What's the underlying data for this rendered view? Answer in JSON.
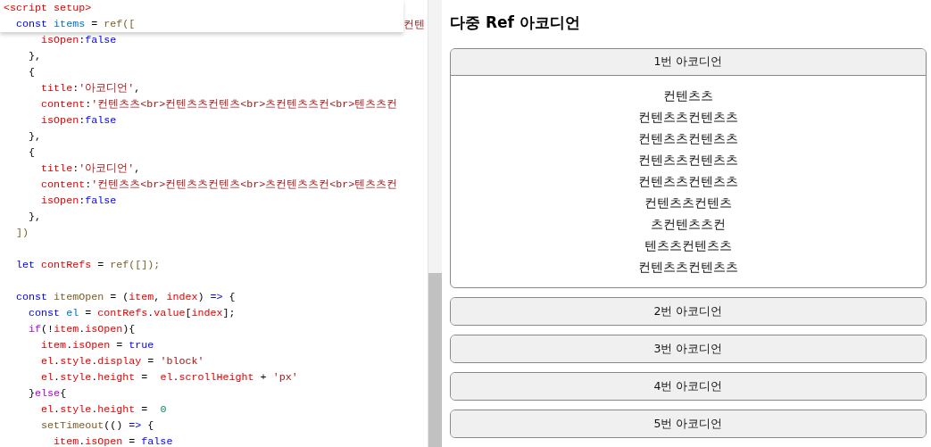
{
  "editor": {
    "sticky_lines": [
      {
        "kind": "code",
        "tokens": [
          {
            "text": "<script setup>",
            "kind": "tag"
          }
        ]
      },
      {
        "kind": "code",
        "tokens": [
          {
            "text": "  const ",
            "kind": "kw"
          },
          {
            "text": "items",
            "kind": "var"
          },
          {
            "text": " = ",
            "kind": "punc"
          },
          {
            "text": "ref",
            "kind": "fn"
          },
          {
            "text": "([",
            "kind": "bracket"
          }
        ]
      }
    ],
    "peek_text": "컨텐",
    "lines": [
      {
        "kind": "code",
        "tokens": [
          {
            "text": "      isOpen",
            "kind": "prop"
          },
          {
            "text": ":",
            "kind": "punc"
          },
          {
            "text": "false",
            "kind": "kw"
          }
        ]
      },
      {
        "kind": "code",
        "tokens": [
          {
            "text": "    },",
            "kind": "punc"
          }
        ]
      },
      {
        "kind": "code",
        "tokens": [
          {
            "text": "    {",
            "kind": "punc"
          }
        ]
      },
      {
        "kind": "code",
        "tokens": [
          {
            "text": "      title",
            "kind": "prop"
          },
          {
            "text": ":",
            "kind": "punc"
          },
          {
            "text": "'아코디언'",
            "kind": "str"
          },
          {
            "text": ",",
            "kind": "punc"
          }
        ]
      },
      {
        "kind": "code",
        "tokens": [
          {
            "text": "      content",
            "kind": "prop"
          },
          {
            "text": ":",
            "kind": "punc"
          },
          {
            "text": "'컨텐츠츠<br>컨텐츠츠컨텐츠<br>츠컨텐츠츠컨<br>텐츠츠컨",
            "kind": "str"
          }
        ]
      },
      {
        "kind": "code",
        "tokens": [
          {
            "text": "      isOpen",
            "kind": "prop"
          },
          {
            "text": ":",
            "kind": "punc"
          },
          {
            "text": "false",
            "kind": "kw"
          }
        ]
      },
      {
        "kind": "code",
        "tokens": [
          {
            "text": "    },",
            "kind": "punc"
          }
        ]
      },
      {
        "kind": "code",
        "tokens": [
          {
            "text": "    {",
            "kind": "punc"
          }
        ]
      },
      {
        "kind": "code",
        "tokens": [
          {
            "text": "      title",
            "kind": "prop"
          },
          {
            "text": ":",
            "kind": "punc"
          },
          {
            "text": "'아코디언'",
            "kind": "str"
          },
          {
            "text": ",",
            "kind": "punc"
          }
        ]
      },
      {
        "kind": "code",
        "tokens": [
          {
            "text": "      content",
            "kind": "prop"
          },
          {
            "text": ":",
            "kind": "punc"
          },
          {
            "text": "'컨텐츠츠<br>컨텐츠츠컨텐츠<br>츠컨텐츠츠컨<br>텐츠츠컨",
            "kind": "str"
          }
        ]
      },
      {
        "kind": "code",
        "tokens": [
          {
            "text": "      isOpen",
            "kind": "prop"
          },
          {
            "text": ":",
            "kind": "punc"
          },
          {
            "text": "false",
            "kind": "kw"
          }
        ]
      },
      {
        "kind": "code",
        "tokens": [
          {
            "text": "    },",
            "kind": "punc"
          }
        ]
      },
      {
        "kind": "code",
        "tokens": [
          {
            "text": "  ])",
            "kind": "bracket"
          }
        ]
      },
      {
        "kind": "blank"
      },
      {
        "kind": "code",
        "tokens": [
          {
            "text": "  let ",
            "kind": "kw"
          },
          {
            "text": "contRefs",
            "kind": "prop"
          },
          {
            "text": " = ",
            "kind": "punc"
          },
          {
            "text": "ref",
            "kind": "fn"
          },
          {
            "text": "([]);",
            "kind": "bracket"
          }
        ]
      },
      {
        "kind": "blank"
      },
      {
        "kind": "code",
        "tokens": [
          {
            "text": "  const ",
            "kind": "kw"
          },
          {
            "text": "itemOpen",
            "kind": "fn"
          },
          {
            "text": " = (",
            "kind": "punc"
          },
          {
            "text": "item",
            "kind": "prop"
          },
          {
            "text": ", ",
            "kind": "punc"
          },
          {
            "text": "index",
            "kind": "prop"
          },
          {
            "text": ") ",
            "kind": "punc"
          },
          {
            "text": "=>",
            "kind": "kw"
          },
          {
            "text": " {",
            "kind": "punc"
          }
        ]
      },
      {
        "kind": "code",
        "tokens": [
          {
            "text": "    const ",
            "kind": "kw"
          },
          {
            "text": "el",
            "kind": "var"
          },
          {
            "text": " = ",
            "kind": "punc"
          },
          {
            "text": "contRefs",
            "kind": "prop"
          },
          {
            "text": ".",
            "kind": "punc"
          },
          {
            "text": "value",
            "kind": "prop"
          },
          {
            "text": "[",
            "kind": "punc"
          },
          {
            "text": "index",
            "kind": "prop"
          },
          {
            "text": "];",
            "kind": "punc"
          }
        ]
      },
      {
        "kind": "code",
        "tokens": [
          {
            "text": "    if",
            "kind": "ctrl"
          },
          {
            "text": "(!",
            "kind": "punc"
          },
          {
            "text": "item",
            "kind": "prop"
          },
          {
            "text": ".",
            "kind": "punc"
          },
          {
            "text": "isOpen",
            "kind": "prop"
          },
          {
            "text": "){",
            "kind": "punc"
          }
        ]
      },
      {
        "kind": "code",
        "tokens": [
          {
            "text": "      item",
            "kind": "prop"
          },
          {
            "text": ".",
            "kind": "punc"
          },
          {
            "text": "isOpen",
            "kind": "prop"
          },
          {
            "text": " = ",
            "kind": "punc"
          },
          {
            "text": "true",
            "kind": "kw"
          }
        ]
      },
      {
        "kind": "code",
        "tokens": [
          {
            "text": "      el",
            "kind": "prop"
          },
          {
            "text": ".",
            "kind": "punc"
          },
          {
            "text": "style",
            "kind": "prop"
          },
          {
            "text": ".",
            "kind": "punc"
          },
          {
            "text": "display",
            "kind": "prop"
          },
          {
            "text": " = ",
            "kind": "punc"
          },
          {
            "text": "'block'",
            "kind": "str"
          }
        ]
      },
      {
        "kind": "code",
        "tokens": [
          {
            "text": "      el",
            "kind": "prop"
          },
          {
            "text": ".",
            "kind": "punc"
          },
          {
            "text": "style",
            "kind": "prop"
          },
          {
            "text": ".",
            "kind": "punc"
          },
          {
            "text": "height",
            "kind": "prop"
          },
          {
            "text": " =  ",
            "kind": "punc"
          },
          {
            "text": "el",
            "kind": "prop"
          },
          {
            "text": ".",
            "kind": "punc"
          },
          {
            "text": "scrollHeight",
            "kind": "prop"
          },
          {
            "text": " + ",
            "kind": "punc"
          },
          {
            "text": "'px'",
            "kind": "str"
          }
        ]
      },
      {
        "kind": "code",
        "tokens": [
          {
            "text": "    }",
            "kind": "punc"
          },
          {
            "text": "else",
            "kind": "ctrl"
          },
          {
            "text": "{",
            "kind": "punc"
          }
        ]
      },
      {
        "kind": "code",
        "tokens": [
          {
            "text": "      el",
            "kind": "prop"
          },
          {
            "text": ".",
            "kind": "punc"
          },
          {
            "text": "style",
            "kind": "prop"
          },
          {
            "text": ".",
            "kind": "punc"
          },
          {
            "text": "height",
            "kind": "prop"
          },
          {
            "text": " =  ",
            "kind": "punc"
          },
          {
            "text": "0",
            "kind": "num"
          }
        ]
      },
      {
        "kind": "code",
        "tokens": [
          {
            "text": "      setTimeout",
            "kind": "fn"
          },
          {
            "text": "(() ",
            "kind": "punc"
          },
          {
            "text": "=>",
            "kind": "kw"
          },
          {
            "text": " {",
            "kind": "punc"
          }
        ]
      },
      {
        "kind": "code",
        "tokens": [
          {
            "text": "        item",
            "kind": "prop"
          },
          {
            "text": ".",
            "kind": "punc"
          },
          {
            "text": "isOpen",
            "kind": "prop"
          },
          {
            "text": " = ",
            "kind": "punc"
          },
          {
            "text": "false",
            "kind": "kw"
          }
        ]
      }
    ]
  },
  "preview": {
    "title": "다중 Ref 아코디언",
    "accordions": [
      {
        "title": "1번 아코디언",
        "isOpen": true,
        "content": [
          "컨텐츠츠",
          "컨텐츠츠컨텐츠츠",
          "컨텐츠츠컨텐츠츠",
          "컨텐츠츠컨텐츠츠",
          "컨텐츠츠컨텐츠츠",
          "컨텐츠츠컨텐츠",
          "츠컨텐츠츠컨",
          "텐츠츠컨텐츠츠",
          "컨텐츠츠컨텐츠츠"
        ]
      },
      {
        "title": "2번 아코디언",
        "isOpen": false
      },
      {
        "title": "3번 아코디언",
        "isOpen": false
      },
      {
        "title": "4번 아코디언",
        "isOpen": false
      },
      {
        "title": "5번 아코디언",
        "isOpen": false
      }
    ]
  }
}
